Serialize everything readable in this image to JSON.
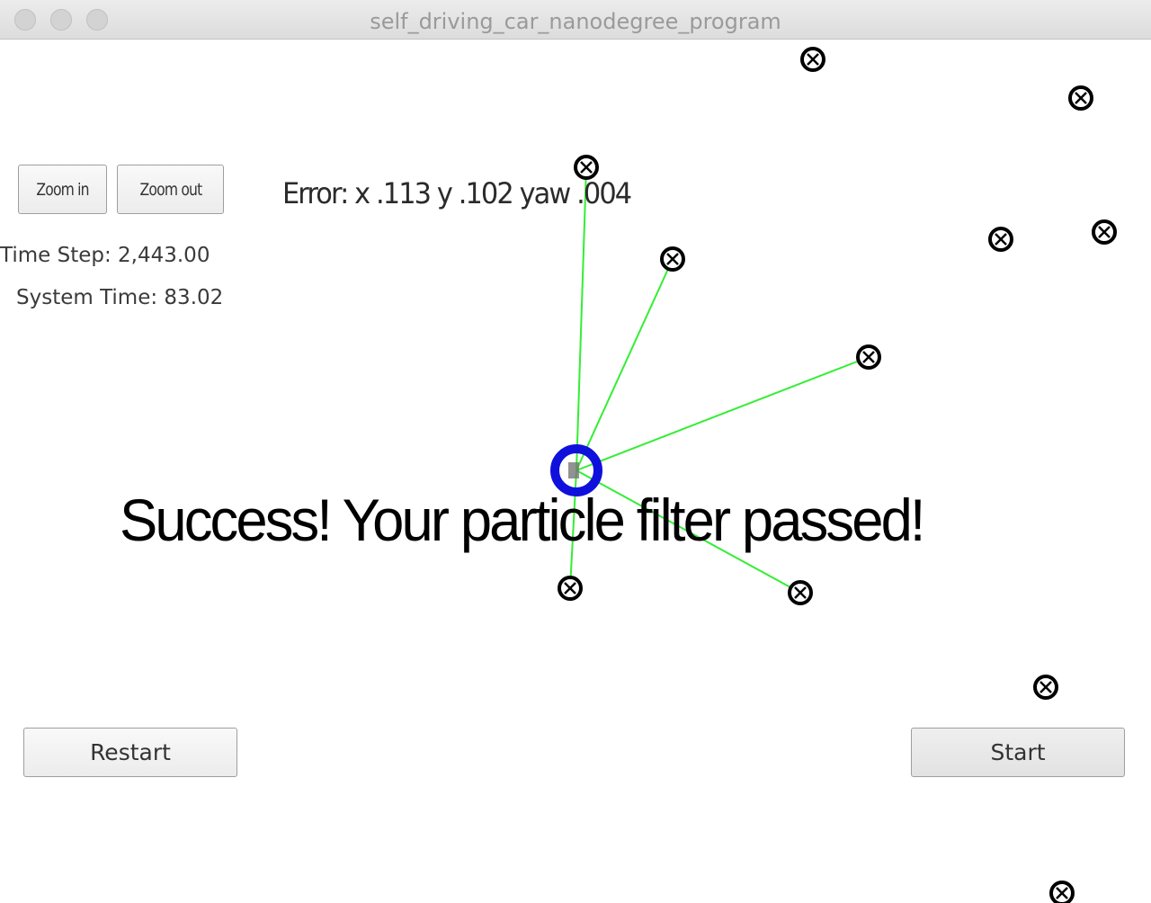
{
  "window": {
    "title": "self_driving_car_nanodegree_program"
  },
  "controls": {
    "zoom_in": "Zoom in",
    "zoom_out": "Zoom out",
    "restart": "Restart",
    "start": "Start"
  },
  "hud": {
    "error": "Error: x .113 y .102 yaw .004",
    "time_step": "Time Step: 2,443.00",
    "system_time": "System Time: 83.02",
    "message": "Success! Your particle filter passed!"
  },
  "colors": {
    "observation_line": "#33ee33",
    "vehicle": "#1010dd",
    "landmark": "#000000"
  },
  "icons": {
    "landmark": "landmark-x-icon",
    "vehicle": "vehicle-marker-icon"
  }
}
